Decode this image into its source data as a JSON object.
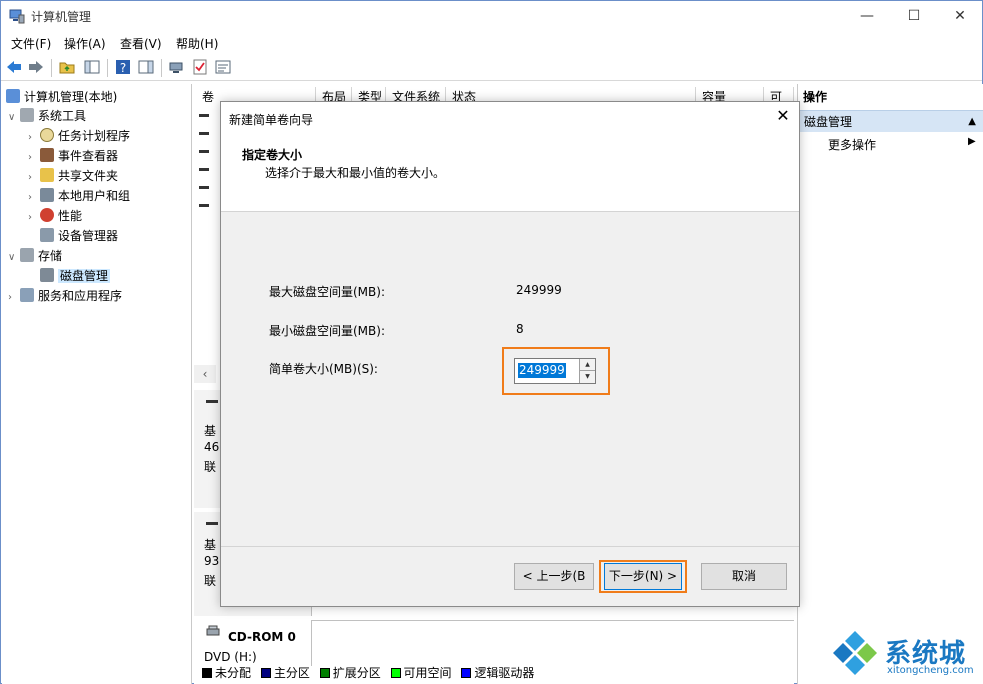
{
  "window": {
    "title": "计算机管理"
  },
  "menu": [
    "文件(F)",
    "操作(A)",
    "查看(V)",
    "帮助(H)"
  ],
  "tree": {
    "root": "计算机管理(本地)",
    "system_tools": "系统工具",
    "task_scheduler": "任务计划程序",
    "event_viewer": "事件查看器",
    "shared_folders": "共享文件夹",
    "local_users": "本地用户和组",
    "performance": "性能",
    "device_manager": "设备管理器",
    "storage": "存储",
    "disk_management": "磁盘管理",
    "services_apps": "服务和应用程序"
  },
  "volume_list": {
    "columns": [
      "卷",
      "布局",
      "类型",
      "文件系统",
      "状态",
      "容量",
      "可"
    ]
  },
  "disks": {
    "disk0_label": "基",
    "disk0_size": "46",
    "disk0_status": "联",
    "disk1_label": "基",
    "disk1_size": "93",
    "disk1_status": "联",
    "cdrom_name": "CD-ROM 0",
    "cdrom_type": "DVD (H:)"
  },
  "legend": {
    "unallocated": "未分配",
    "primary": "主分区",
    "extended": "扩展分区",
    "free": "可用空间",
    "logical": "逻辑驱动器"
  },
  "actions": {
    "header": "操作",
    "section": "磁盘管理",
    "more": "更多操作"
  },
  "dialog": {
    "title": "新建简单卷向导",
    "heading": "指定卷大小",
    "subtitle": "选择介于最大和最小值的卷大小。",
    "max_label": "最大磁盘空间量(MB):",
    "max_value": "249999",
    "min_label": "最小磁盘空间量(MB):",
    "min_value": "8",
    "size_label": "简单卷大小(MB)(S):",
    "size_value": "249999",
    "back_button": "< 上一步(B",
    "next_button": "下一步(N) >",
    "cancel_button": "取消"
  },
  "watermark": {
    "name": "系统城",
    "url": "xitongcheng.com"
  },
  "colors": {
    "highlight": "#f07c1a",
    "selection": "#0078d7",
    "unallocated": "#000000",
    "primary": "#00007f",
    "extended": "#007f00",
    "free": "#00ff00",
    "logical": "#0000ff"
  }
}
